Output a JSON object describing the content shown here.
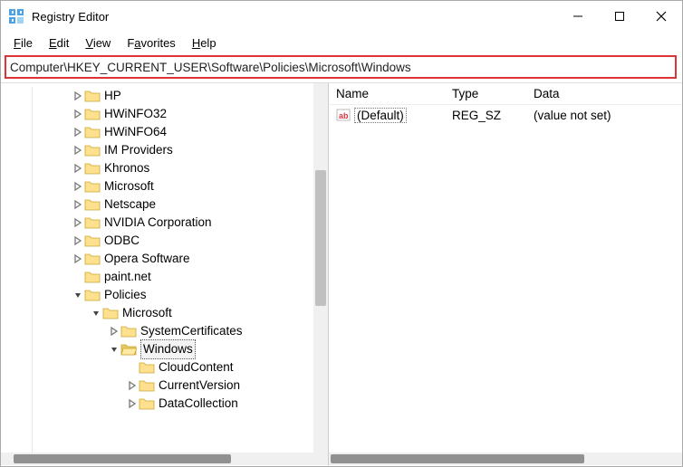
{
  "window": {
    "title": "Registry Editor"
  },
  "menu": {
    "file": "File",
    "edit": "Edit",
    "view": "View",
    "favorites": "Favorites",
    "help": "Help"
  },
  "address": "Computer\\HKEY_CURRENT_USER\\Software\\Policies\\Microsoft\\Windows",
  "tree": {
    "items": [
      {
        "indent": 78,
        "caret": "r",
        "label": "HP"
      },
      {
        "indent": 78,
        "caret": "r",
        "label": "HWiNFO32"
      },
      {
        "indent": 78,
        "caret": "r",
        "label": "HWiNFO64"
      },
      {
        "indent": 78,
        "caret": "r",
        "label": "IM Providers"
      },
      {
        "indent": 78,
        "caret": "r",
        "label": "Khronos"
      },
      {
        "indent": 78,
        "caret": "r",
        "label": "Microsoft"
      },
      {
        "indent": 78,
        "caret": "r",
        "label": "Netscape"
      },
      {
        "indent": 78,
        "caret": "r",
        "label": "NVIDIA Corporation"
      },
      {
        "indent": 78,
        "caret": "r",
        "label": "ODBC"
      },
      {
        "indent": 78,
        "caret": "r",
        "label": "Opera Software"
      },
      {
        "indent": 78,
        "caret": "",
        "label": "paint.net"
      },
      {
        "indent": 78,
        "caret": "d",
        "label": "Policies"
      },
      {
        "indent": 98,
        "caret": "d",
        "label": "Microsoft"
      },
      {
        "indent": 118,
        "caret": "r",
        "label": "SystemCertificates"
      },
      {
        "indent": 118,
        "caret": "d",
        "open": true,
        "selected": true,
        "label": "Windows"
      },
      {
        "indent": 138,
        "caret": "",
        "label": "CloudContent"
      },
      {
        "indent": 138,
        "caret": "r",
        "label": "CurrentVersion"
      },
      {
        "indent": 138,
        "caret": "r",
        "label": "DataCollection"
      }
    ]
  },
  "list": {
    "headers": {
      "name": "Name",
      "type": "Type",
      "data": "Data"
    },
    "rows": [
      {
        "name": "(Default)",
        "type": "REG_SZ",
        "data": "(value not set)"
      }
    ]
  }
}
